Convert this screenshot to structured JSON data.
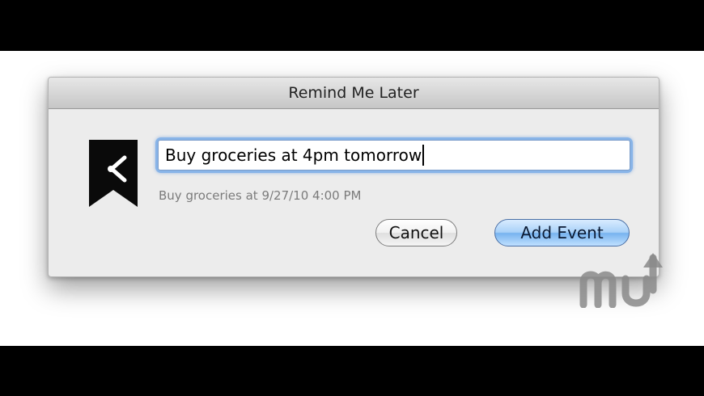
{
  "window": {
    "title": "Remind Me Later"
  },
  "event_input": {
    "value": "Buy groceries at 4pm tomorrow"
  },
  "parsed_preview": "Buy groceries at 9/27/10 4:00 PM",
  "buttons": {
    "cancel_label": "Cancel",
    "add_label": "Add Event"
  },
  "icons": {
    "app_icon": "bookmark-clock-icon",
    "watermark": "macupdate-logo"
  },
  "colors": {
    "default_button": "#77b3ef",
    "focus_ring": "#88b4e8"
  }
}
